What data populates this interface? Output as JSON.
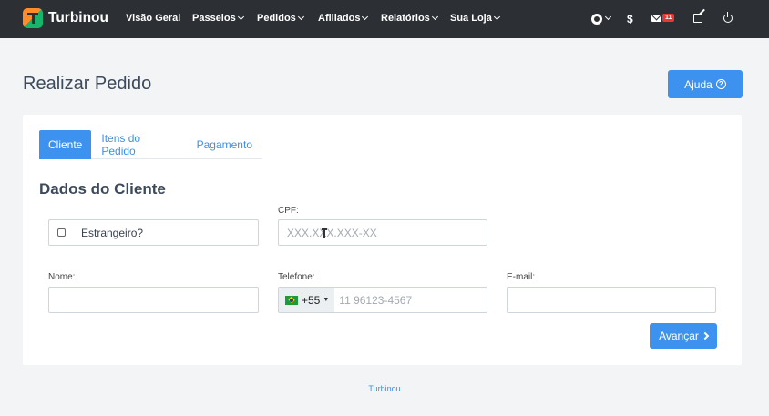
{
  "navbar": {
    "brand": "Turbinou",
    "items": [
      {
        "label": "Visão Geral",
        "dropdown": false
      },
      {
        "label": "Passeios",
        "dropdown": true
      },
      {
        "label": "Pedidos",
        "dropdown": true
      },
      {
        "label": "Afiliados",
        "dropdown": true
      },
      {
        "label": "Relatórios",
        "dropdown": true
      },
      {
        "label": "Sua Loja",
        "dropdown": true
      }
    ],
    "dollar": "$",
    "mail_badge": "11"
  },
  "header": {
    "title": "Realizar Pedido",
    "help_label": "Ajuda"
  },
  "tabs": [
    {
      "label": "Cliente",
      "active": true
    },
    {
      "label": "Itens do Pedido",
      "active": false
    },
    {
      "label": "Pagamento",
      "active": false
    }
  ],
  "form": {
    "section_title": "Dados do Cliente",
    "foreigner_label": "Estrangeiro?",
    "cpf_label": "CPF:",
    "cpf_placeholder": "XXX.XXX.XXX-XX",
    "name_label": "Nome:",
    "phone_label": "Telefone:",
    "phone_prefix": "+55",
    "phone_placeholder": "11 96123-4567",
    "email_label": "E-mail:",
    "next_label": "Avançar"
  },
  "footer": {
    "text": "Turbinou"
  },
  "colors": {
    "navbar": "#2c3035",
    "primary": "#3d92f0",
    "badge": "#e53935"
  }
}
